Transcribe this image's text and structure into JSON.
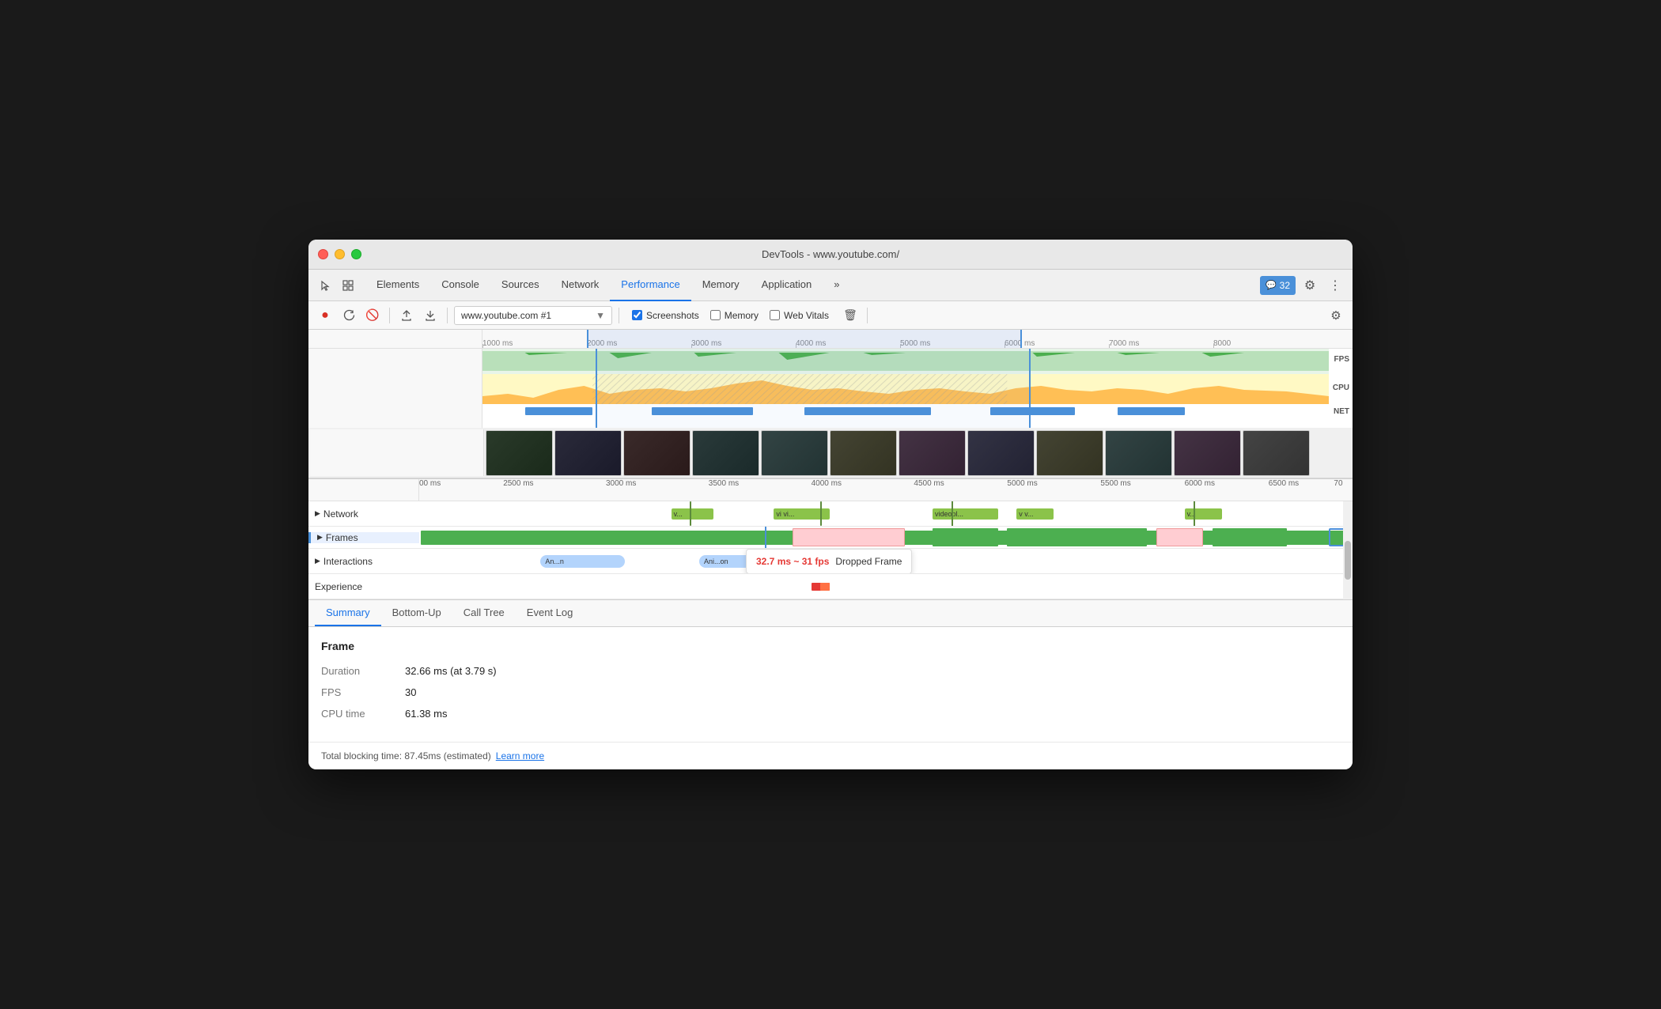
{
  "window": {
    "title": "DevTools - www.youtube.com/"
  },
  "traffic_lights": {
    "red": "red-light",
    "yellow": "yellow-light",
    "green": "green-light"
  },
  "devtools_tabs": {
    "items": [
      {
        "label": "Elements",
        "active": false
      },
      {
        "label": "Console",
        "active": false
      },
      {
        "label": "Sources",
        "active": false
      },
      {
        "label": "Network",
        "active": false
      },
      {
        "label": "Performance",
        "active": true
      },
      {
        "label": "Memory",
        "active": false
      },
      {
        "label": "Application",
        "active": false
      }
    ],
    "more_label": "»",
    "badge_count": "32",
    "settings_icon": "⚙",
    "more_icon": "⋮"
  },
  "toolbar": {
    "record_icon": "●",
    "reload_icon": "↺",
    "clear_icon": "🚫",
    "upload_icon": "⬆",
    "download_icon": "⬇",
    "url_value": "www.youtube.com #1",
    "screenshots_label": "Screenshots",
    "screenshots_checked": true,
    "memory_label": "Memory",
    "memory_checked": false,
    "web_vitals_label": "Web Vitals",
    "web_vitals_checked": false,
    "delete_icon": "🗑",
    "settings_icon": "⚙"
  },
  "timeline": {
    "ruler_ticks": [
      "1000 ms",
      "2000 ms",
      "3000 ms",
      "4000 ms",
      "5000 ms",
      "6000 ms",
      "7000 ms",
      "8000"
    ],
    "fps_label": "FPS",
    "cpu_label": "CPU",
    "net_label": "NET",
    "ruler2_labels": [
      "00 ms",
      "2500 ms",
      "3000 ms",
      "3500 ms",
      "4000 ms",
      "4500 ms",
      "5000 ms",
      "5500 ms",
      "6000 ms",
      "6500 ms",
      "70"
    ]
  },
  "rows": {
    "network_label": "Network",
    "frames_label": "Frames",
    "interactions_label": "Interactions",
    "experience_label": "Experience",
    "network_events": [
      {
        "label": "v...",
        "left": "27%",
        "width": "4%",
        "color": "#8bc34a"
      },
      {
        "label": "vi vi...",
        "left": "38%",
        "width": "6%",
        "color": "#8bc34a"
      },
      {
        "label": "videopl...",
        "left": "55%",
        "width": "7%",
        "color": "#8bc34a"
      },
      {
        "label": "v v...",
        "left": "64%",
        "width": "4%",
        "color": "#8bc34a"
      },
      {
        "label": "v...",
        "left": "82%",
        "width": "4%",
        "color": "#8bc34a"
      }
    ],
    "interaction_events": [
      {
        "label": "An...n",
        "left": "13%",
        "width": "8%"
      },
      {
        "label": "Ani...on",
        "left": "30%",
        "width": "8%"
      }
    ],
    "dropped_frame": {
      "left": "37%",
      "fps_text": "32.7 ms ~ 31 fps",
      "label_text": "Dropped Frame"
    }
  },
  "bottom_panel": {
    "tabs": [
      "Summary",
      "Bottom-Up",
      "Call Tree",
      "Event Log"
    ],
    "active_tab": "Summary",
    "frame_title": "Frame",
    "stats": [
      {
        "label": "Duration",
        "value": "32.66 ms (at 3.79 s)"
      },
      {
        "label": "FPS",
        "value": "30"
      },
      {
        "label": "CPU time",
        "value": "61.38 ms"
      }
    ],
    "footer_text": "Total blocking time: 87.45ms (estimated)",
    "learn_more": "Learn more"
  }
}
